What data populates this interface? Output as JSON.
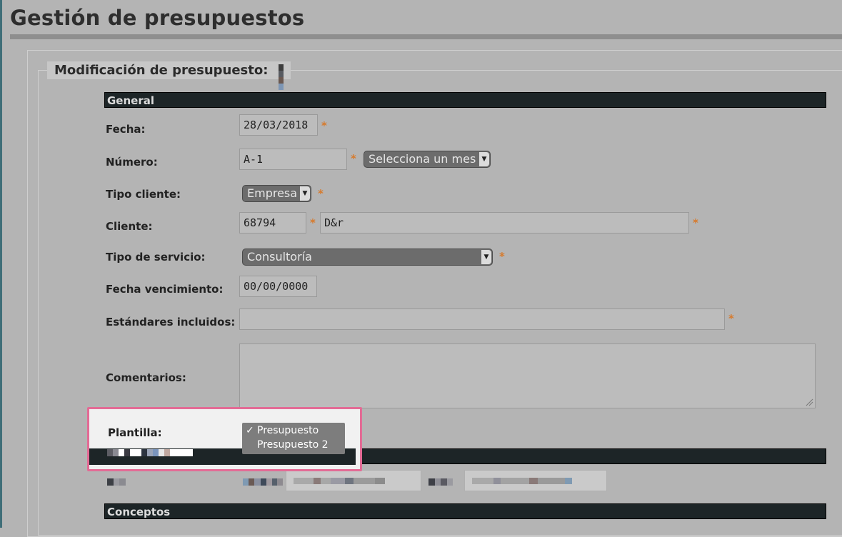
{
  "page": {
    "title": "Gestión de presupuestos"
  },
  "form": {
    "legend": "Modificación de presupuesto:"
  },
  "sections": {
    "general": "General",
    "conceptos": "Conceptos"
  },
  "fields": {
    "fecha": {
      "label": "Fecha:",
      "value": "28/03/2018",
      "required": "*"
    },
    "numero": {
      "label": "Número:",
      "value": "A-1",
      "required": "*",
      "month_select": "Selecciona un mes"
    },
    "tipo_cliente": {
      "label": "Tipo cliente:",
      "value": "Empresa",
      "required": "*"
    },
    "cliente": {
      "label": "Cliente:",
      "code": "68794",
      "name": "D&r",
      "required": "*"
    },
    "tipo_servicio": {
      "label": "Tipo de servicio:",
      "value": "Consultoría",
      "required": "*"
    },
    "fecha_vencimiento": {
      "label": "Fecha vencimiento:",
      "value": "00/00/0000"
    },
    "estandares": {
      "label": "Estándares incluidos:",
      "value": "",
      "required": "*"
    },
    "comentarios": {
      "label": "Comentarios:",
      "value": ""
    },
    "plantilla": {
      "label": "Plantilla:",
      "options": [
        {
          "label": "Presupuesto",
          "check": "✓"
        },
        {
          "label": "Presupuesto 2",
          "check": ""
        }
      ]
    }
  },
  "colors": {
    "accent_star": "#d77a2c",
    "highlight_border": "#e36b95",
    "section_bar": "#1d2527"
  },
  "icons": {
    "select_arrow": "chevron-down-icon",
    "resize": "resize-grip-icon"
  }
}
